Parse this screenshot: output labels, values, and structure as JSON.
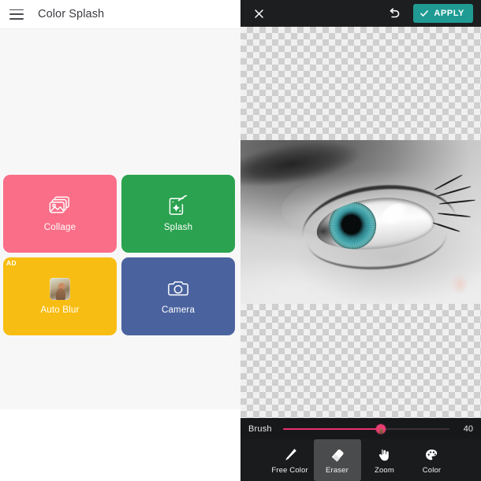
{
  "left": {
    "appbar": {
      "menu_icon": "hamburger-menu-icon",
      "title": "Color Splash"
    },
    "tiles": [
      {
        "label": "Collage",
        "icon": "photo-stack-icon",
        "color": "#fa6e87",
        "badge": null
      },
      {
        "label": "Splash",
        "icon": "magic-wand-icon",
        "color": "#2ba24f",
        "badge": null
      },
      {
        "label": "Auto Blur",
        "icon": "photo-thumb-icon",
        "color": "#f8bd12",
        "badge": "AD"
      },
      {
        "label": "Camera",
        "icon": "camera-icon",
        "color": "#4a639f",
        "badge": null
      }
    ]
  },
  "editor": {
    "topbar": {
      "close_icon": "close-icon",
      "undo_icon": "undo-arrow-icon",
      "apply_label": "APPLY",
      "apply_icon": "check-icon",
      "apply_color": "#1f9b93"
    },
    "canvas": {
      "transparency_checker": true,
      "photo_description": "grayscale close-up of an eye with colorized teal-blue iris"
    },
    "brush": {
      "label": "Brush",
      "value": "40",
      "percent": 59,
      "accent_color": "#ea3d72"
    },
    "tools": [
      {
        "label": "Free Color",
        "icon": "pen-icon",
        "active": false
      },
      {
        "label": "Eraser",
        "icon": "eraser-icon",
        "active": true
      },
      {
        "label": "Zoom",
        "icon": "hand-icon",
        "active": false
      },
      {
        "label": "Color",
        "icon": "palette-icon",
        "active": false
      }
    ]
  }
}
